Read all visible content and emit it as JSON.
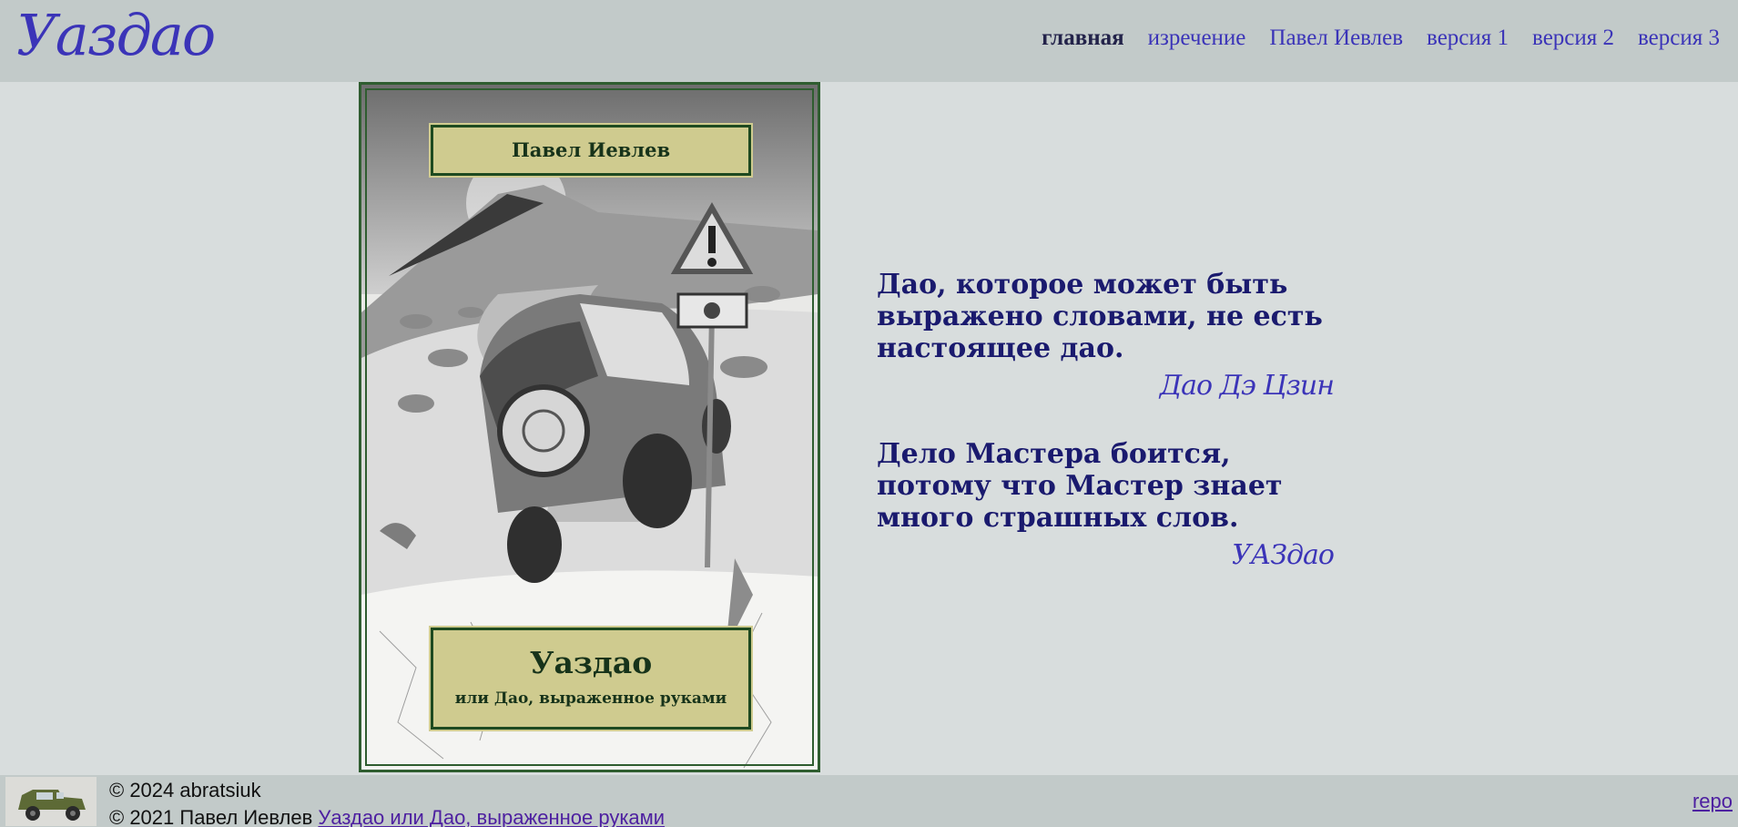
{
  "header": {
    "logo": "Уаздао",
    "nav": [
      {
        "label": "главная",
        "active": true
      },
      {
        "label": "изречение",
        "active": false
      },
      {
        "label": "Павел Иевлев",
        "active": false
      },
      {
        "label": "версия 1",
        "active": false
      },
      {
        "label": "версия 2",
        "active": false
      },
      {
        "label": "версия 3",
        "active": false
      }
    ]
  },
  "cover": {
    "author": "Павел Иевлев",
    "title": "Уаздао",
    "subtitle": "или Дао, выраженное руками"
  },
  "quotes": [
    {
      "text": "Дао, которое может быть выражено словами, не есть настоящее дао.",
      "author": "Дао Дэ Цзин"
    },
    {
      "text": "Дело Мастера боится, потому что Мастер знает много страшных слов.",
      "author": "УАЗдао"
    }
  ],
  "footer": {
    "line1": "© 2024 abratsiuk",
    "line2_prefix": "© 2021 Павел Иевлев ",
    "line2_link": "Уаздао или Дао, выраженное руками",
    "repo": "repo"
  }
}
